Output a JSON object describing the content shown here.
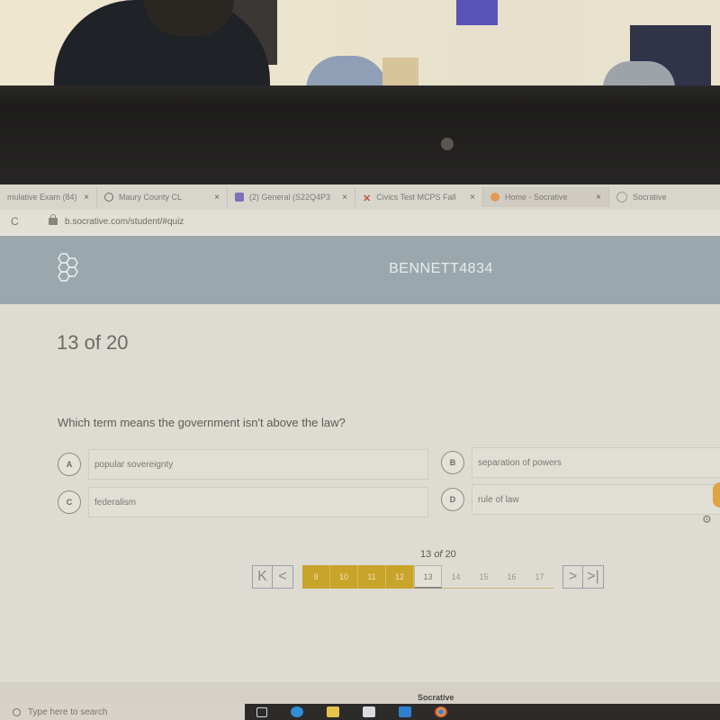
{
  "browser": {
    "tabs": [
      {
        "label": "mulative Exam (84)",
        "icon": "socrative-icon",
        "close": "×"
      },
      {
        "label": "Maury County CL",
        "icon": "info-circle-icon",
        "close": "×"
      },
      {
        "label": "(2) General (S22Q4P3",
        "icon": "teams-icon",
        "close": "×"
      },
      {
        "label": "Civics Test MCPS Fall",
        "icon": "quiz-x-icon",
        "close": "×"
      },
      {
        "label": "Home - Socrative",
        "icon": "socrative-orange-icon",
        "close": "×"
      },
      {
        "label": "Socrative",
        "icon": "socrative-logo-icon",
        "close": ""
      }
    ],
    "reload_glyph": "C",
    "url": "b.socrative.com/student/#quiz"
  },
  "app": {
    "username": "BENNETT4834",
    "progress_text": "13 of 20",
    "question": "Which term means the government isn't above the law?",
    "answers": [
      {
        "letter": "A",
        "text": "popular sovereignty"
      },
      {
        "letter": "B",
        "text": "separation of powers"
      },
      {
        "letter": "C",
        "text": "federalism"
      },
      {
        "letter": "D",
        "text": "rule of law"
      }
    ],
    "pager": {
      "current": "13",
      "of_word": "of",
      "total": "20",
      "first_glyph": "K",
      "prev_glyph": "<",
      "next_glyph": ">",
      "last_glyph": ">|",
      "pages": [
        {
          "num": "9",
          "state": "answered"
        },
        {
          "num": "10",
          "state": "answered"
        },
        {
          "num": "11",
          "state": "answered"
        },
        {
          "num": "12",
          "state": "answered"
        },
        {
          "num": "13",
          "state": "current"
        },
        {
          "num": "14",
          "state": "unanswered"
        },
        {
          "num": "15",
          "state": "unanswered"
        },
        {
          "num": "16",
          "state": "unanswered"
        },
        {
          "num": "17",
          "state": "unanswered"
        }
      ]
    },
    "colors": {
      "answered": "#c9a42a",
      "header": "#9aa7ad"
    }
  },
  "taskbar": {
    "search_placeholder": "Type here to search",
    "hover_label": "Socrative",
    "icons": [
      "task-view-icon",
      "edge-icon",
      "file-explorer-icon",
      "store-icon",
      "mail-icon",
      "chrome-icon"
    ]
  }
}
